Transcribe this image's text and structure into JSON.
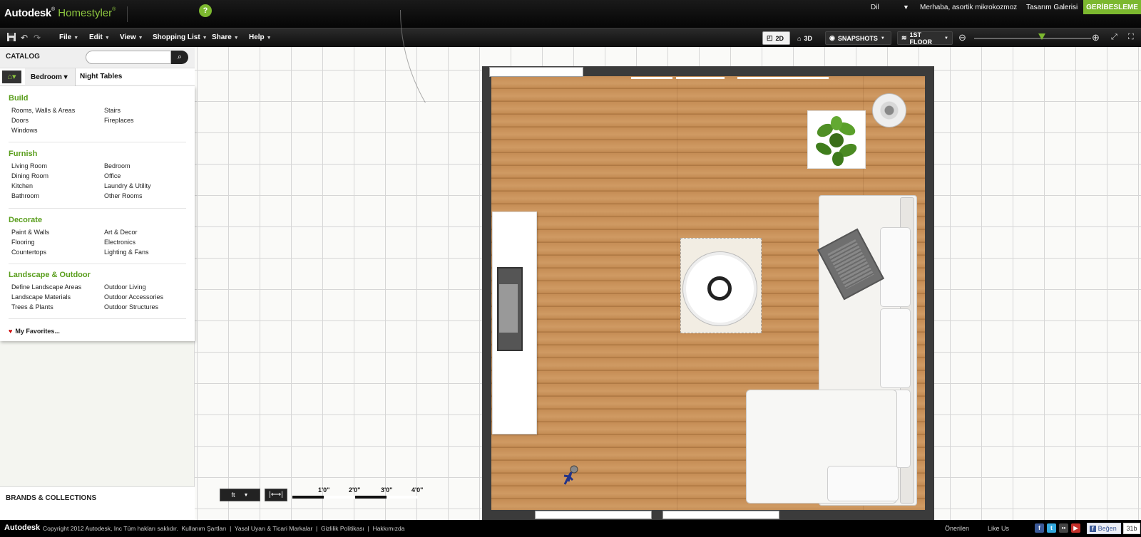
{
  "header": {
    "brand": "Autodesk",
    "product": "Homestyler",
    "language": "Dil",
    "greeting": "Merhaba, asortik mikrokozmoz",
    "gallery": "Tasarım Galerisi",
    "feedback": "GERİBESLEME"
  },
  "menu": {
    "items": [
      "File",
      "Edit",
      "View",
      "Shopping List",
      "Share",
      "Help"
    ],
    "view_2d": "2D",
    "view_3d": "3D",
    "snapshots": "SNAPSHOTS",
    "floor": "1ST FLOOR",
    "zoom_level": 0.58
  },
  "catalog": {
    "title": "CATALOG",
    "search_placeholder": "",
    "breadcrumb": [
      "Bedroom",
      "Night Tables"
    ],
    "sections": [
      {
        "title": "Build",
        "items": [
          "Rooms, Walls & Areas",
          "Stairs",
          "Doors",
          "Fireplaces",
          "Windows"
        ]
      },
      {
        "title": "Furnish",
        "items": [
          "Living Room",
          "Bedroom",
          "Dining Room",
          "Office",
          "Kitchen",
          "Laundry & Utility",
          "Bathroom",
          "Other Rooms"
        ]
      },
      {
        "title": "Decorate",
        "items": [
          "Paint & Walls",
          "Art & Decor",
          "Flooring",
          "Electronics",
          "Countertops",
          "Lighting & Fans"
        ]
      },
      {
        "title": "Landscape & Outdoor",
        "items": [
          "Define Landscape Areas",
          "Outdoor Living",
          "Landscape Materials",
          "Outdoor Accessories",
          "Trees & Plants",
          "Outdoor Structures"
        ]
      }
    ],
    "favorites": "My Favorites...",
    "brands": "BRANDS & COLLECTIONS"
  },
  "canvas": {
    "unit": "ft",
    "scale_labels": [
      "1'0\"",
      "2'0\"",
      "3'0\"",
      "4'0\""
    ]
  },
  "footer": {
    "brand": "Autodesk",
    "copyright": "Copyright 2012 Autodesk, Inc Tüm hakları saklıdır.",
    "links": [
      "Kullanım Şartları",
      "Yasal Uyarı & Ticari Markalar",
      "Gizlilik Politikası",
      "Hakkımızda"
    ],
    "suggestions": "Önerilen",
    "like_us": "Like Us",
    "like_button": "Beğen",
    "like_count": "31b"
  },
  "colors": {
    "accent": "#7cb82f",
    "category_heading": "#5a9e1d"
  }
}
